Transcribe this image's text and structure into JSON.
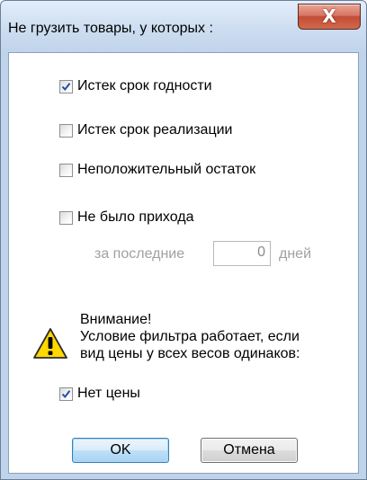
{
  "window": {
    "title": "Не грузить товары, у которых :",
    "close_glyph": "X"
  },
  "options": [
    {
      "label": "Истек срок годности",
      "checked": true
    },
    {
      "label": "Истек срок реализации",
      "checked": false
    },
    {
      "label": "Неположительный остаток",
      "checked": false
    },
    {
      "label": "Не было прихода",
      "checked": false
    }
  ],
  "period": {
    "prefix": "за последние",
    "value": "0",
    "suffix": "дней"
  },
  "warning": {
    "icon": "warning-icon",
    "line1": "Внимание!",
    "line2": "Условие фильтра работает, если",
    "line3": "вид цены у всех весов одинаков:"
  },
  "no_price": {
    "label": "Нет цены",
    "checked": true
  },
  "buttons": {
    "ok": "OK",
    "cancel": "Отмена"
  },
  "colors": {
    "check": "#1f4fa8",
    "warning_yellow": "#ffd800"
  }
}
